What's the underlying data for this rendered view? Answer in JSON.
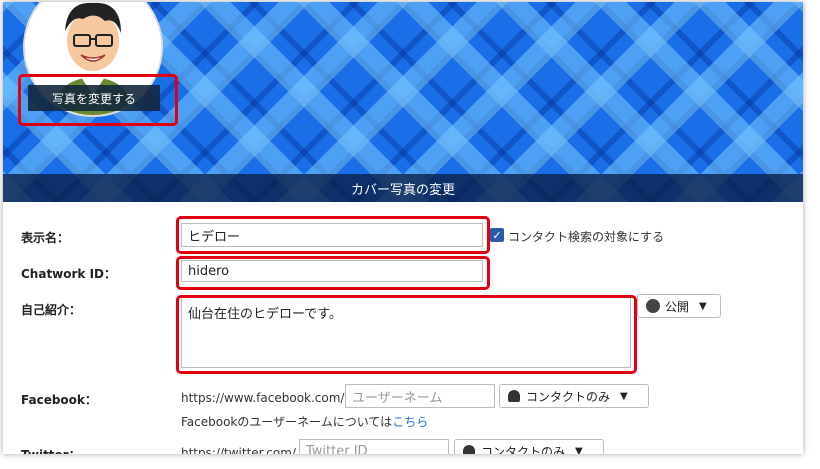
{
  "cover": {
    "change_photo_label": "写真を変更する",
    "change_cover_label": "カバー写真の変更"
  },
  "form": {
    "display_name": {
      "label": "表示名：",
      "value": "ヒデロー"
    },
    "contact_search": {
      "label": "コンタクト検索の対象にする",
      "checked": true
    },
    "chatwork_id": {
      "label": "Chatwork ID：",
      "value": "hidero"
    },
    "bio": {
      "label": "自己紹介：",
      "value": "仙台在住のヒデローです。"
    },
    "bio_visibility": {
      "label": "公開",
      "icon": "globe-icon"
    },
    "facebook": {
      "label": "Facebook：",
      "prefix": "https://www.facebook.com/",
      "placeholder": "ユーザーネーム",
      "visibility": "コンタクトのみ",
      "help_text": "Facebookのユーザーネームについては",
      "help_link": "こちら"
    },
    "twitter": {
      "label": "Twitter：",
      "prefix": "https://twitter.com/",
      "placeholder": "Twitter ID",
      "visibility": "コンタクトのみ"
    }
  }
}
